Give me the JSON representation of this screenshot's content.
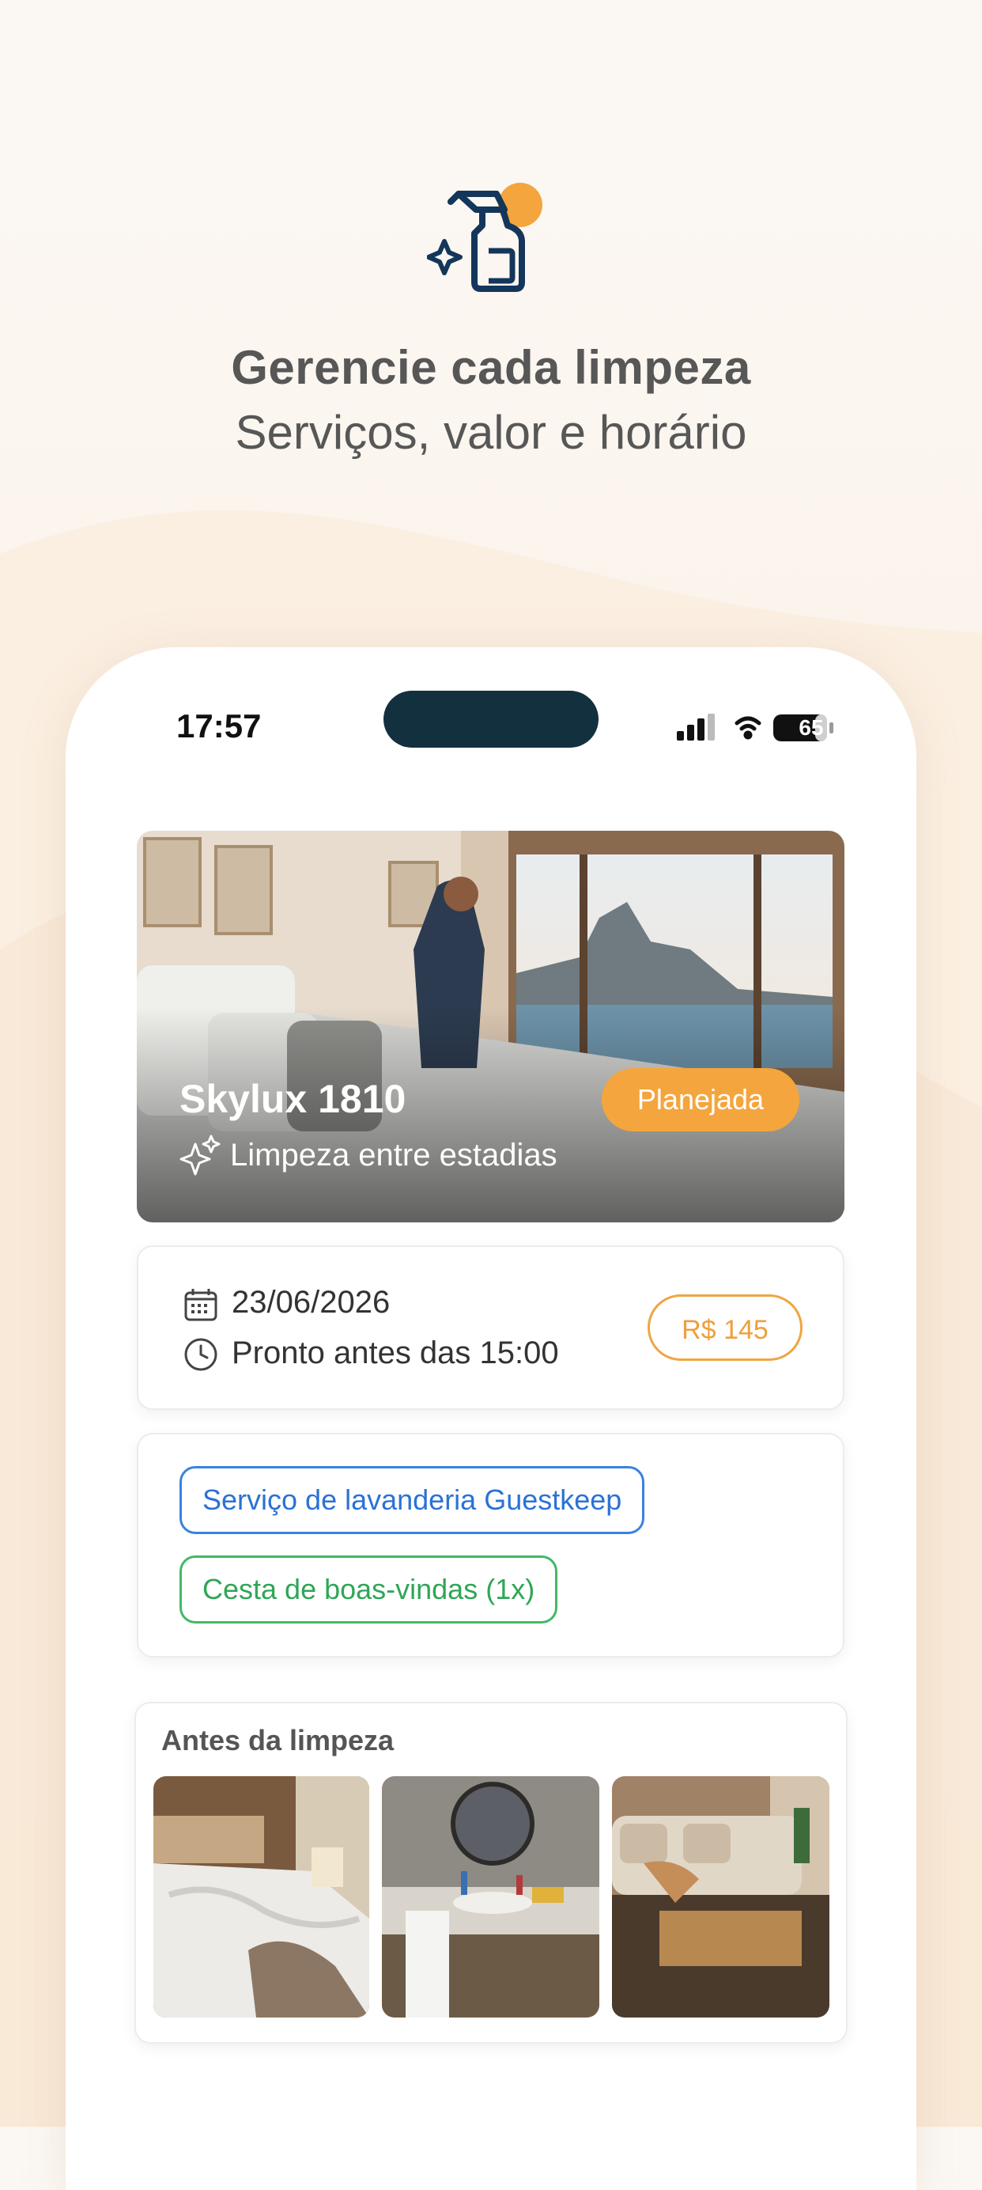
{
  "headline": "Gerencie cada limpeza",
  "subline": "Serviços, valor e horário",
  "status_bar": {
    "time": "17:57",
    "battery": "65"
  },
  "cleaning": {
    "property": "Skylux 1810",
    "type": "Limpeza entre estadias",
    "status": "Planejada",
    "date": "23/06/2026",
    "ready_by": "Pronto antes das 15:00",
    "price": "R$ 145"
  },
  "services": [
    "Serviço de lavanderia Guestkeep",
    "Cesta de boas-vindas (1x)"
  ],
  "before": {
    "title": "Antes da limpeza"
  },
  "colors": {
    "accent_orange": "#f4a53e",
    "navy": "#14365a",
    "blue_tag": "#2a72d6",
    "green_tag": "#2fa657"
  },
  "icons": [
    "cleaning-spray-icon",
    "sparkle-icon",
    "calendar-icon",
    "clock-icon",
    "signal-icon",
    "wifi-icon",
    "battery-icon"
  ]
}
